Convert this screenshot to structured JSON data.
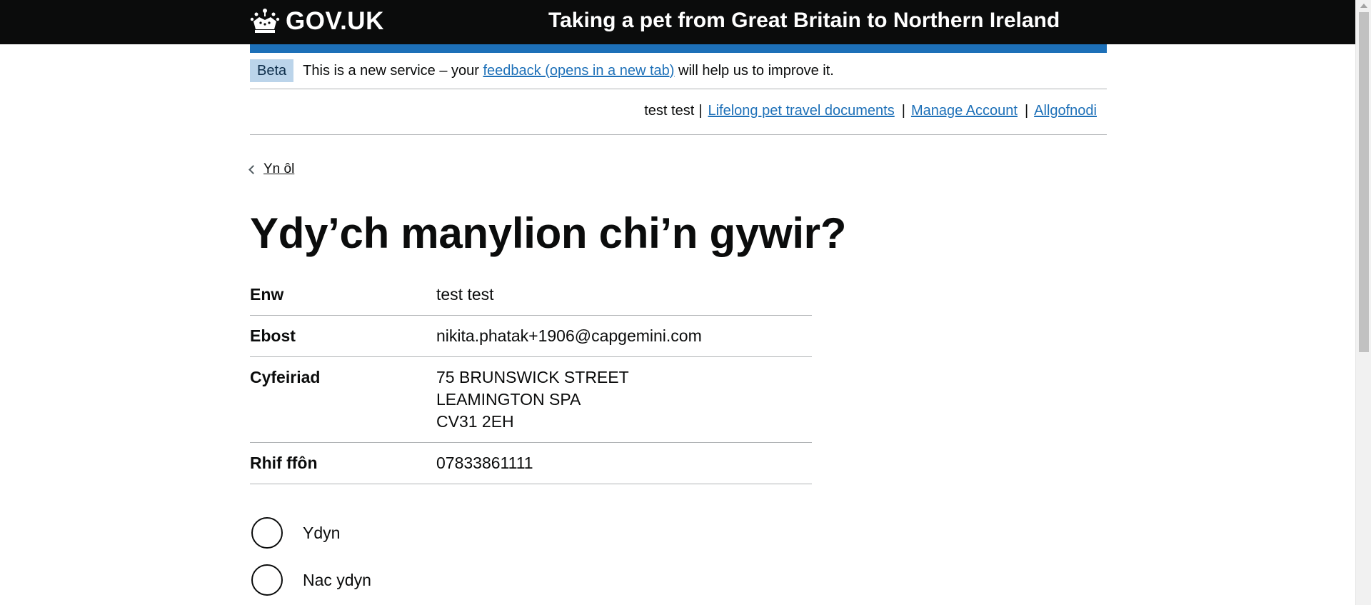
{
  "header": {
    "logo_text": "GOV.UK",
    "service_name": "Taking a pet from Great Britain to Northern Ireland"
  },
  "phase_banner": {
    "tag": "Beta",
    "text_before": "This is a new service – your ",
    "link_text": "feedback (opens in a new tab)",
    "text_after": " will help us to improve it."
  },
  "account_bar": {
    "user_name": "test test",
    "sep": "|",
    "links": [
      "Lifelong pet travel documents",
      "Manage Account",
      "Allgofnodi"
    ]
  },
  "back_link": "Yn ôl",
  "title": "Ydy’ch manylion chi’n gywir?",
  "summary": {
    "rows": [
      {
        "key": "Enw",
        "values": [
          "test test"
        ]
      },
      {
        "key": "Ebost",
        "values": [
          "nikita.phatak+1906@capgemini.com"
        ]
      },
      {
        "key": "Cyfeiriad",
        "values": [
          "75 BRUNSWICK STREET",
          "LEAMINGTON SPA",
          "CV31 2EH"
        ]
      },
      {
        "key": "Rhif ffôn",
        "values": [
          "07833861111"
        ]
      }
    ]
  },
  "radios": {
    "options": [
      "Ydyn",
      "Nac ydyn"
    ]
  },
  "colors": {
    "header_bg": "#0b0c0c",
    "brand_blue": "#1d70b8",
    "beta_tag_bg": "#bbd4ea",
    "border": "#b1b4b6"
  },
  "icons": {
    "logo": "crown-icon",
    "back": "chevron-left-icon"
  }
}
